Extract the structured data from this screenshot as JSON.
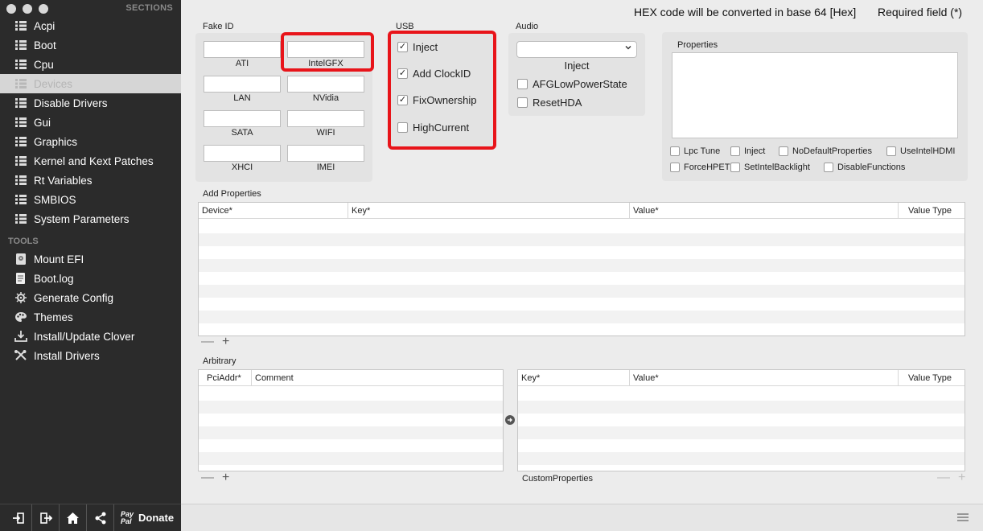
{
  "sidebar": {
    "sections_header": "SECTIONS",
    "items": [
      {
        "label": "Acpi",
        "icon": "list-icon",
        "selected": false
      },
      {
        "label": "Boot",
        "icon": "list-icon",
        "selected": false
      },
      {
        "label": "Cpu",
        "icon": "list-icon",
        "selected": false
      },
      {
        "label": "Devices",
        "icon": "list-icon",
        "selected": true
      },
      {
        "label": "Disable Drivers",
        "icon": "list-icon",
        "selected": false
      },
      {
        "label": "Gui",
        "icon": "list-icon",
        "selected": false
      },
      {
        "label": "Graphics",
        "icon": "list-icon",
        "selected": false
      },
      {
        "label": "Kernel and Kext Patches",
        "icon": "list-icon",
        "selected": false
      },
      {
        "label": "Rt Variables",
        "icon": "list-icon",
        "selected": false
      },
      {
        "label": "SMBIOS",
        "icon": "list-icon",
        "selected": false
      },
      {
        "label": "System Parameters",
        "icon": "list-icon",
        "selected": false
      }
    ],
    "tools_header": "TOOLS",
    "tools": [
      {
        "label": "Mount EFI",
        "icon": "disk-icon"
      },
      {
        "label": "Boot.log",
        "icon": "document-icon"
      },
      {
        "label": "Generate Config",
        "icon": "gear-icon"
      },
      {
        "label": "Themes",
        "icon": "palette-icon"
      },
      {
        "label": "Install/Update Clover",
        "icon": "download-icon"
      },
      {
        "label": "Install Drivers",
        "icon": "tools-icon"
      }
    ],
    "footer": {
      "paypal_top": "Pay",
      "paypal_bottom": "Pal",
      "donate_label": "Donate"
    }
  },
  "header": {
    "hex_note": "HEX code will be converted in base 64 [Hex]",
    "required_note": "Required field (*)"
  },
  "fake_id": {
    "title": "Fake ID",
    "fields": [
      {
        "label": "ATI",
        "value": ""
      },
      {
        "label": "IntelGFX",
        "value": ""
      },
      {
        "label": "LAN",
        "value": ""
      },
      {
        "label": "NVidia",
        "value": ""
      },
      {
        "label": "SATA",
        "value": ""
      },
      {
        "label": "WIFI",
        "value": ""
      },
      {
        "label": "XHCI",
        "value": ""
      },
      {
        "label": "IMEI",
        "value": ""
      }
    ]
  },
  "usb": {
    "title": "USB",
    "options": [
      {
        "label": "Inject",
        "checked": true
      },
      {
        "label": "Add ClockID",
        "checked": true
      },
      {
        "label": "FixOwnership",
        "checked": true
      },
      {
        "label": "HighCurrent",
        "checked": false
      }
    ]
  },
  "audio": {
    "title": "Audio",
    "inject_value": "",
    "inject_label": "Inject",
    "options": [
      {
        "label": "AFGLowPowerState",
        "checked": false
      },
      {
        "label": "ResetHDA",
        "checked": false
      }
    ]
  },
  "properties": {
    "title": "Properties",
    "value": "",
    "options": [
      {
        "label": "Lpc Tune",
        "checked": false
      },
      {
        "label": "Inject",
        "checked": false
      },
      {
        "label": "NoDefaultProperties",
        "checked": false
      },
      {
        "label": "UseIntelHDMI",
        "checked": false
      },
      {
        "label": "ForceHPET",
        "checked": false
      },
      {
        "label": "SetIntelBacklight",
        "checked": false
      },
      {
        "label": "DisableFunctions",
        "checked": false
      }
    ]
  },
  "add_properties": {
    "title": "Add Properties",
    "columns": [
      "Device*",
      "Key*",
      "Value*",
      "Value Type"
    ],
    "rows": []
  },
  "arbitrary": {
    "title": "Arbitrary",
    "left_columns": [
      "PciAddr*",
      "Comment"
    ],
    "right_columns": [
      "Key*",
      "Value*",
      "Value Type"
    ],
    "custom_properties_label": "CustomProperties",
    "rows": []
  },
  "controls": {
    "minus": "—",
    "plus": "+",
    "check": "✓"
  }
}
